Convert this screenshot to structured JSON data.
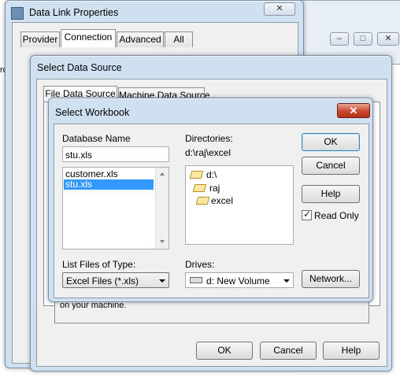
{
  "data_link": {
    "title": "Data Link Properties",
    "tabs": [
      "Provider",
      "Connection",
      "Advanced",
      "All"
    ],
    "buttons": {
      "ok": "OK",
      "cancel": "Cancel",
      "help": "Help"
    },
    "obscured_text": "on your machine."
  },
  "select_data_source": {
    "title": "Select Data Source",
    "tabs": [
      "File Data Source",
      "Machine Data Source"
    ]
  },
  "select_workbook": {
    "title": "Select Workbook",
    "database_name_label": "Database Name",
    "database_name_value": "stu.xls",
    "files": [
      {
        "name": "customer.xls",
        "selected": false
      },
      {
        "name": "stu.xls",
        "selected": true
      }
    ],
    "directories_label": "Directories:",
    "current_path": "d:\\raj\\excel",
    "directories": [
      {
        "name": "d:\\",
        "level": 0
      },
      {
        "name": "raj",
        "level": 1
      },
      {
        "name": "excel",
        "level": 2
      }
    ],
    "file_type_label": "List Files of Type:",
    "file_type_value": "Excel Files (*.xls)",
    "drives_label": "Drives:",
    "drives_value": "d: New Volume",
    "buttons": {
      "ok": "OK",
      "cancel": "Cancel",
      "help": "Help",
      "network": "Network..."
    },
    "read_only_label": "Read Only",
    "read_only_checked": true
  },
  "background_window": {
    "edge_text": "ro"
  }
}
